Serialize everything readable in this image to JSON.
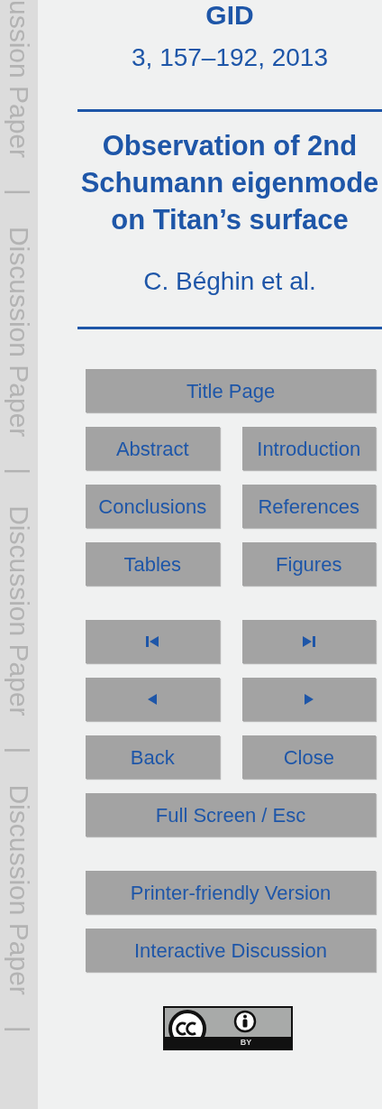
{
  "margin_labels": [
    {
      "text": "ussion Paper"
    },
    {
      "text": "|"
    },
    {
      "text": "Discussion Paper"
    },
    {
      "text": "|"
    },
    {
      "text": "Discussion Paper"
    },
    {
      "text": "|"
    },
    {
      "text": "Discussion Paper"
    },
    {
      "text": "|"
    }
  ],
  "header": {
    "journal": "GID",
    "citation": "3, 157–192, 2013",
    "title": "Observation of 2nd Schumann eigenmode on Titan’s surface",
    "authors": "C. Béghin et al."
  },
  "button_groups": [
    [
      [
        {
          "kind": "text",
          "label": "Title Page"
        }
      ],
      [
        {
          "kind": "text",
          "label": "Abstract"
        },
        {
          "kind": "text",
          "label": "Introduction"
        }
      ],
      [
        {
          "kind": "text",
          "label": "Conclusions"
        },
        {
          "kind": "text",
          "label": "References"
        }
      ],
      [
        {
          "kind": "text",
          "label": "Tables"
        },
        {
          "kind": "text",
          "label": "Figures"
        }
      ]
    ],
    [
      [
        {
          "kind": "first"
        },
        {
          "kind": "last"
        }
      ],
      [
        {
          "kind": "prev"
        },
        {
          "kind": "next"
        }
      ],
      [
        {
          "kind": "text",
          "label": "Back"
        },
        {
          "kind": "text",
          "label": "Close"
        }
      ],
      [
        {
          "kind": "text",
          "label": "Full Screen / Esc"
        }
      ]
    ],
    [
      [
        {
          "kind": "text",
          "label": "Printer-friendly Version"
        }
      ],
      [
        {
          "kind": "text",
          "label": "Interactive Discussion"
        }
      ]
    ]
  ],
  "license_badge": {
    "label": "BY"
  }
}
